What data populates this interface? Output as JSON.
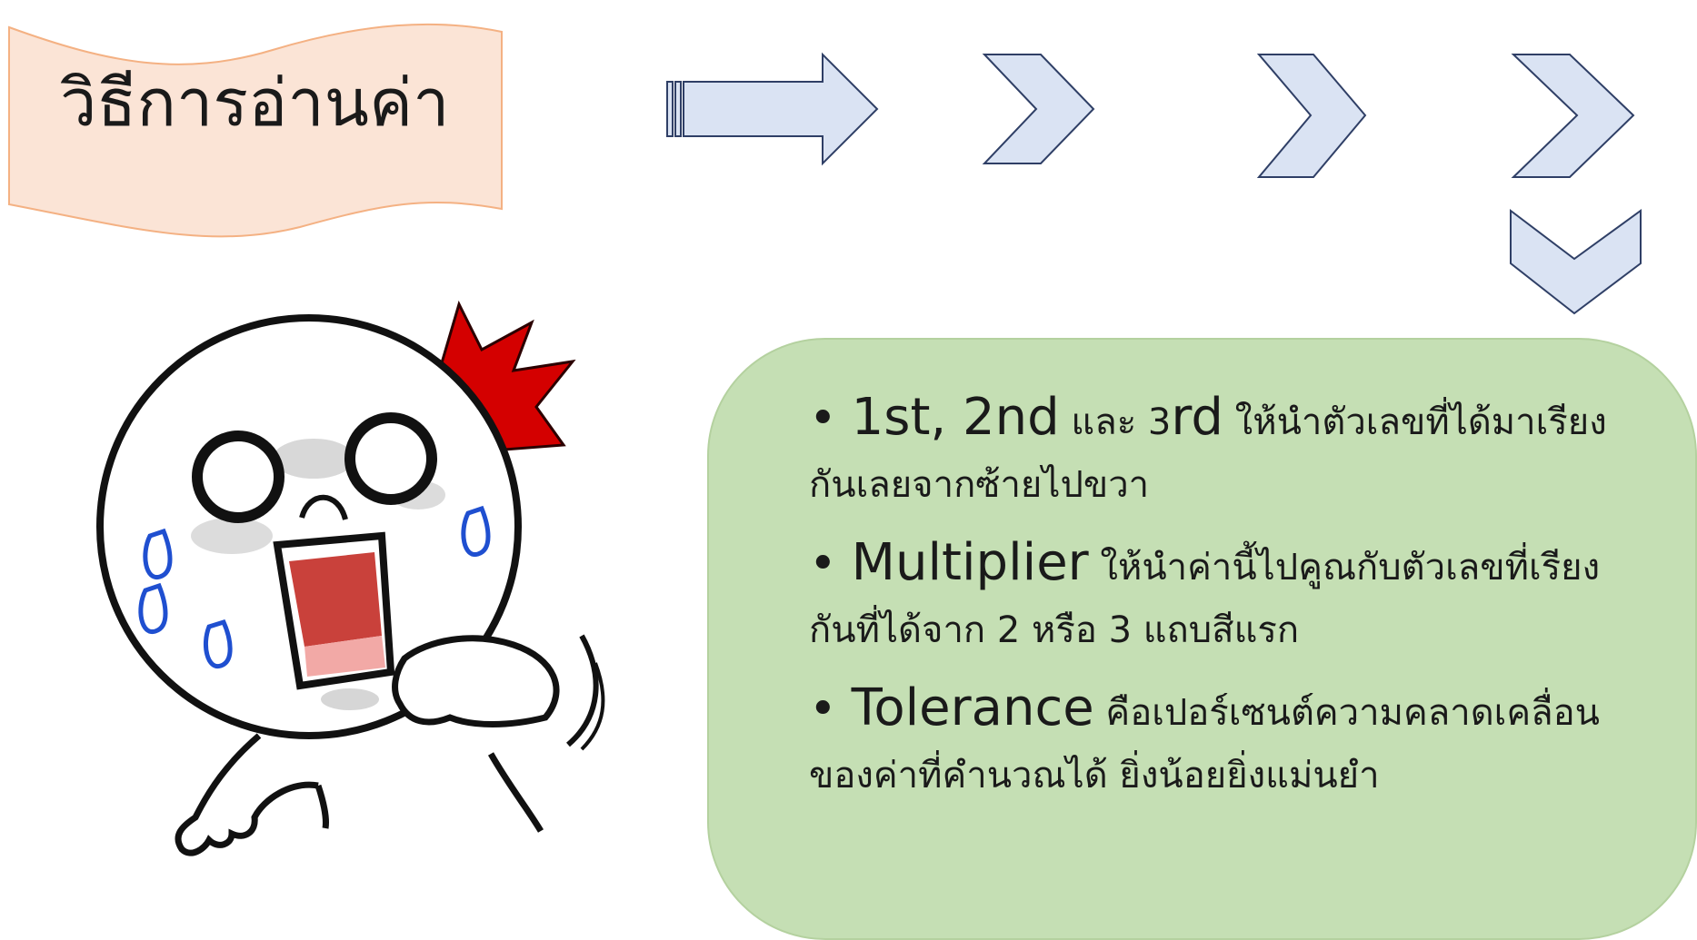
{
  "title": "วิธีการอ่านค่า",
  "bullets": [
    {
      "term": "1st, 2nd",
      "connector": " และ 3",
      "term2": "rd",
      "text1": " ให้นำตัวเลขที่ได้มาเรียง",
      "text2": "กันเลยจากซ้ายไปขวา"
    },
    {
      "term": "Multiplier",
      "text1": " ให้นำค่านี้ไปคูณกับตัวเลขที่เรียง",
      "text2": "กันที่ได้จาก 2 หรือ 3 แถบสีแรก"
    },
    {
      "term": "Tolerance",
      "text1": " คือเปอร์เซนต์ความคลาดเคลื่อน",
      "text2": "ของค่าที่คำนวณได้ ยิ่งน้อยยิ่งแม่นยำ"
    }
  ],
  "colors": {
    "banner_fill": "#fbe4d6",
    "banner_stroke": "#f4b183",
    "arrow_fill": "#dae3f3",
    "arrow_stroke": "#2f3f66",
    "box_fill": "#c5dfb4",
    "accent_red": "#d40000",
    "tear_blue": "#1f4fd0"
  },
  "icons": {
    "flow_arrow": "block-arrow-right-icon",
    "chevron": "chevron-right-icon",
    "chevron_down": "chevron-down-icon",
    "character": "shocked-cartoon-character"
  }
}
